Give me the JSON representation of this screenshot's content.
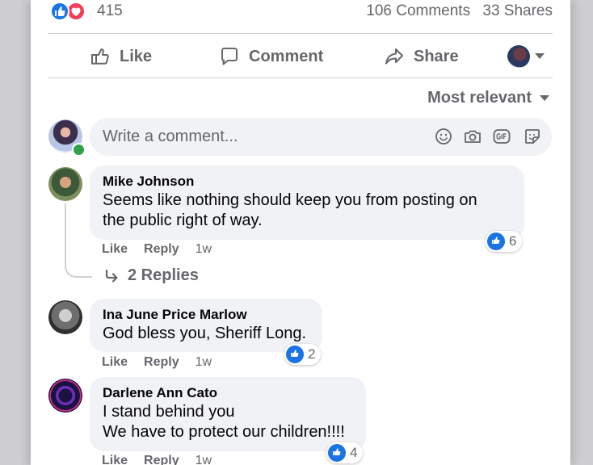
{
  "post_stats": {
    "reaction_count": "415",
    "comments": "106 Comments",
    "shares": "33 Shares",
    "reaction_icons": [
      "like-icon",
      "love-icon"
    ]
  },
  "actions": {
    "like": "Like",
    "comment": "Comment",
    "share": "Share"
  },
  "sort": {
    "label": "Most relevant"
  },
  "composer": {
    "placeholder": "Write a comment..."
  },
  "comments": [
    {
      "name": "Mike Johnson",
      "text": "Seems like nothing should keep you from posting on\nthe public right of way.",
      "like": "Like",
      "reply": "Reply",
      "time": "1w",
      "reactions": "6",
      "replies_label": "2 Replies"
    },
    {
      "name": "Ina June Price Marlow",
      "text": "God bless you, Sheriff Long.",
      "like": "Like",
      "reply": "Reply",
      "time": "1w",
      "reactions": "2"
    },
    {
      "name": "Darlene Ann Cato",
      "text": "I stand behind you\nWe have to protect our children!!!!",
      "like": "Like",
      "reply": "Reply",
      "time": "1w",
      "reactions": "4"
    }
  ],
  "colors": {
    "accent_blue": "#1b74e4",
    "love_red": "#f33e58",
    "secondary_text": "#65676b",
    "bubble_bg": "#f0f2f5",
    "online_green": "#31a24c"
  }
}
